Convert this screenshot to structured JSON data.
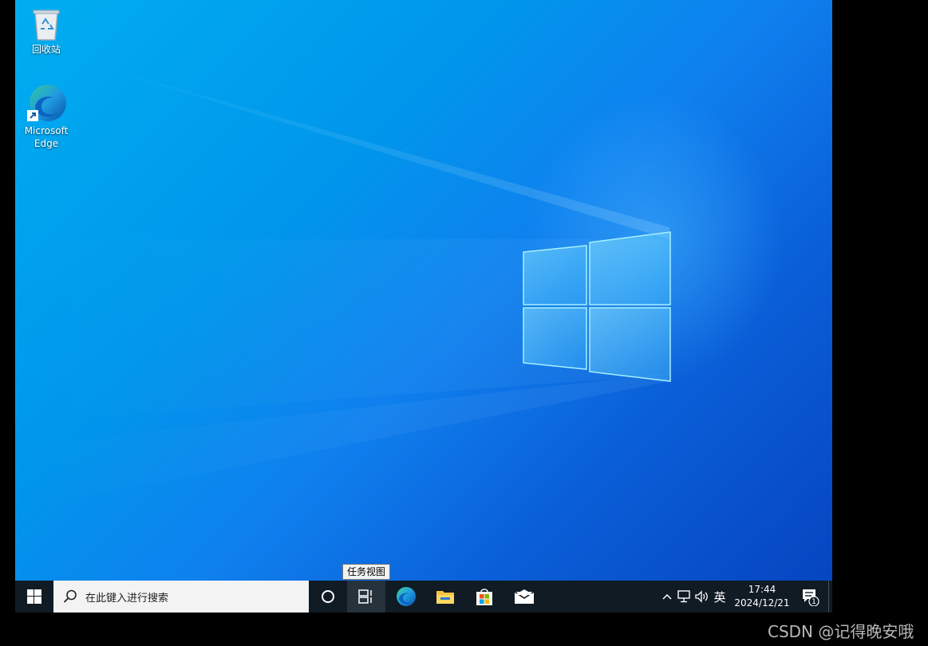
{
  "desktop": {
    "icons": [
      {
        "label": "回收站",
        "icon": "recycle-bin-icon"
      },
      {
        "label_line1": "Microsoft",
        "label_line2": "Edge",
        "icon": "edge-icon"
      }
    ]
  },
  "tooltip": {
    "text": "任务视图"
  },
  "taskbar": {
    "start": {
      "icon": "windows-logo-icon"
    },
    "search": {
      "placeholder": "在此键入进行搜索",
      "icon": "search-icon"
    },
    "cortana": {
      "icon": "cortana-circle-icon"
    },
    "task_view": {
      "icon": "task-view-icon"
    },
    "pinned_apps": [
      {
        "name": "Microsoft Edge",
        "icon": "edge-icon"
      },
      {
        "name": "File Explorer",
        "icon": "folder-icon"
      },
      {
        "name": "Microsoft Store",
        "icon": "store-icon"
      },
      {
        "name": "Mail",
        "icon": "mail-icon"
      }
    ],
    "tray": {
      "chevron": "^",
      "ime": "英",
      "time": "17:44",
      "date": "2024/12/21",
      "notification_count": "1"
    }
  },
  "watermark": {
    "text": "CSDN @记得晚安哦"
  },
  "colors": {
    "taskbar_bg": "#101b24",
    "search_bg": "#f3f3f3",
    "wallpaper_light": "#00aef0",
    "wallpaper_dark": "#0645c0"
  }
}
